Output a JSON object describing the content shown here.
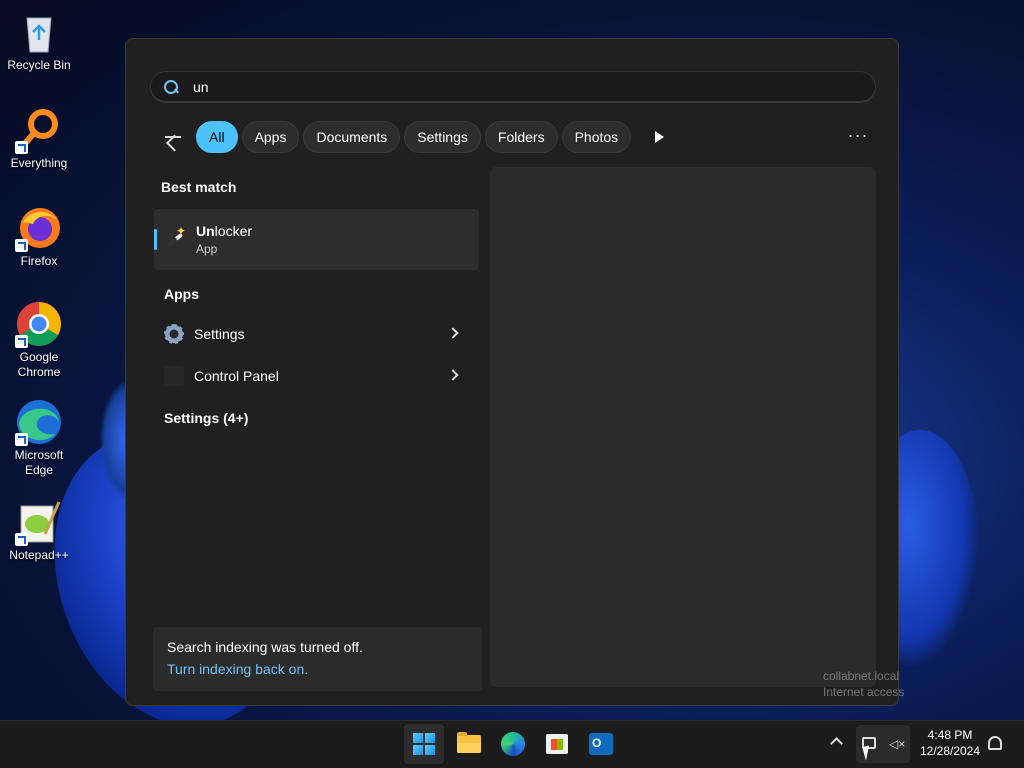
{
  "desktop": {
    "icons": [
      {
        "label": "Recycle Bin",
        "icon": "recycle-bin-icon"
      },
      {
        "label": "Everything",
        "icon": "everything-search-icon"
      },
      {
        "label": "Firefox",
        "icon": "firefox-icon"
      },
      {
        "label": "Google Chrome",
        "icon": "chrome-icon"
      },
      {
        "label": "Microsoft Edge",
        "icon": "edge-icon"
      },
      {
        "label": "Notepad++",
        "icon": "notepadpp-icon"
      }
    ]
  },
  "search": {
    "query": "un"
  },
  "filters": [
    "All",
    "Apps",
    "Documents",
    "Settings",
    "Folders",
    "Photos"
  ],
  "filters_active": "All",
  "results": {
    "best_match_title": "Best match",
    "best_match": {
      "name_bold": "Un",
      "name_rest": "locker",
      "type": "App"
    },
    "apps_title": "Apps",
    "apps": [
      {
        "label": "Settings",
        "icon": "gear-icon"
      },
      {
        "label": "Control Panel",
        "icon": "control-panel-icon"
      }
    ],
    "settings_title": "Settings (4+)"
  },
  "indexing": {
    "message": "Search indexing was turned off.",
    "link": "Turn indexing back on."
  },
  "watermark": {
    "line1": "collabnet.local",
    "line2": "Internet access"
  },
  "taskbar": {
    "apps": [
      "start-icon",
      "file-explorer-icon",
      "edge-icon",
      "store-icon",
      "outlook-icon"
    ],
    "time": "4:48 PM",
    "date": "12/28/2024"
  },
  "colors": {
    "accent": "#4cc2ff",
    "link": "#6fc3f5",
    "panel": "#202020"
  }
}
